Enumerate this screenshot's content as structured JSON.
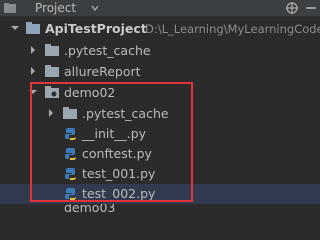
{
  "header": {
    "title": "Project",
    "icon": "project-folder-icon",
    "actions": [
      "dropdown-caret-icon",
      "crosshair-gear-icon",
      "hide-icon"
    ]
  },
  "tree": {
    "root": {
      "name": "ApiTestProject",
      "path": "D:\\L_Learning\\MyLearningCode"
    },
    "items": [
      {
        "name": ".pytest_cache",
        "type": "folder",
        "expanded": false
      },
      {
        "name": "allureReport",
        "type": "folder",
        "expanded": false
      },
      {
        "name": "demo02",
        "type": "folder",
        "expanded": true
      },
      {
        "name": ".pytest_cache",
        "type": "folder",
        "expanded": false
      },
      {
        "name": "__init__.py",
        "type": "python-file"
      },
      {
        "name": "conftest.py",
        "type": "python-file"
      },
      {
        "name": "test_001.py",
        "type": "python-file"
      },
      {
        "name": "test_002.py",
        "type": "python-file",
        "selected": true
      }
    ],
    "partial_last": "demo03"
  },
  "highlight": {
    "color": "#e0333a"
  }
}
